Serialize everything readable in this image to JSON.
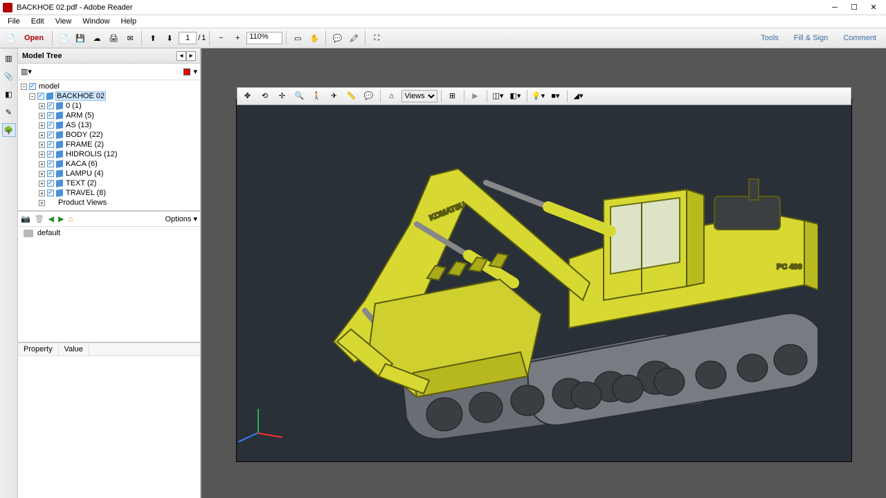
{
  "title": "BACKHOE 02.pdf - Adobe Reader",
  "menu": {
    "file": "File",
    "edit": "Edit",
    "view": "View",
    "window": "Window",
    "help": "Help"
  },
  "toolbar": {
    "open": "Open",
    "page_current": "1",
    "page_sep": "/",
    "page_total": "1",
    "zoom": "110%",
    "tools": "Tools",
    "fillsign": "Fill & Sign",
    "comment": "Comment"
  },
  "sidepanel": {
    "title": "Model Tree",
    "options": "Options",
    "default_folder": "default",
    "property": "Property",
    "value": "Value"
  },
  "tree": {
    "root": "model",
    "n0": "BACKHOE 02",
    "items": [
      {
        "label": "0 (1)"
      },
      {
        "label": "ARM (5)"
      },
      {
        "label": "AS (13)"
      },
      {
        "label": "BODY (22)"
      },
      {
        "label": "FRAME (2)"
      },
      {
        "label": "HIDROLIS (12)"
      },
      {
        "label": "KACA (6)"
      },
      {
        "label": "LAMPU (4)"
      },
      {
        "label": "TEXT (2)"
      },
      {
        "label": "TRAVEL (8)"
      },
      {
        "label": "Product Views"
      }
    ]
  },
  "viewer3d": {
    "views_label": "Views"
  },
  "model_labels": {
    "brand": "KOMATSU",
    "model": "PC 400"
  }
}
